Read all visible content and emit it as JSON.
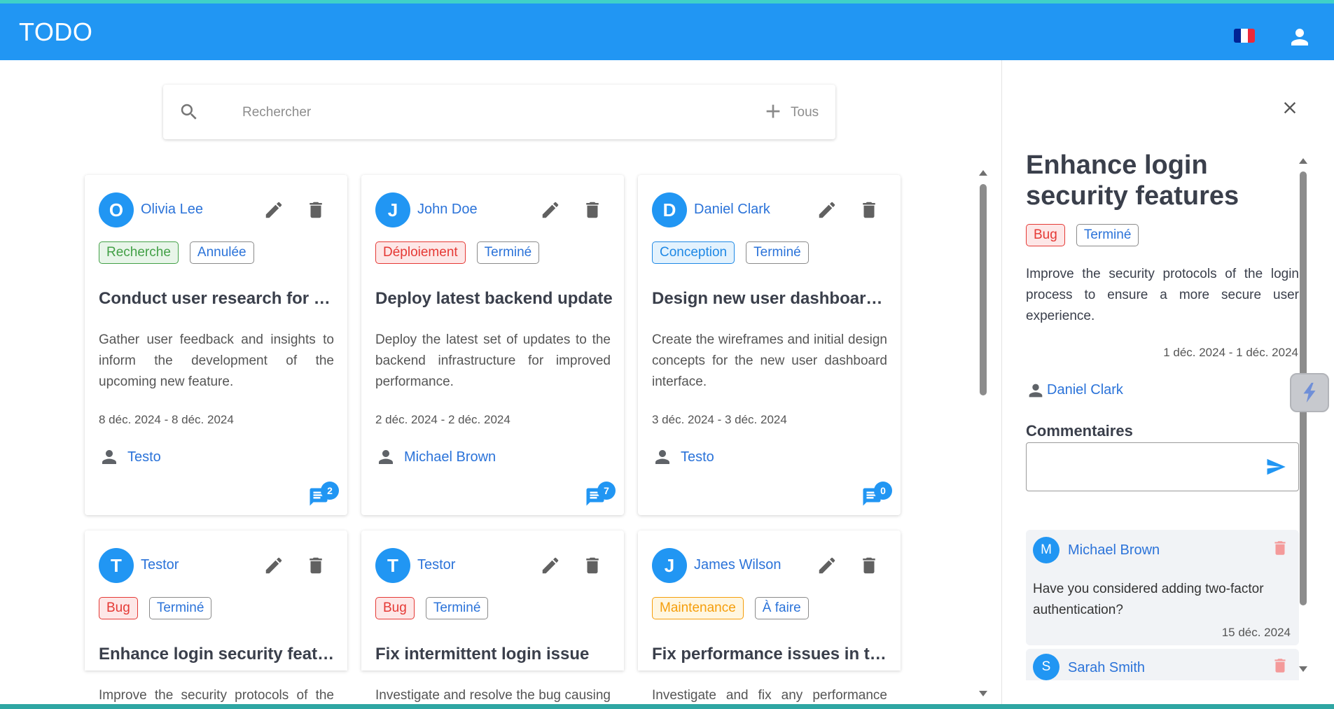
{
  "app": {
    "title": "TODO"
  },
  "flag": {
    "colors": [
      "#002395",
      "#ffffff",
      "#ed2939"
    ]
  },
  "search": {
    "placeholder": "Rechercher",
    "filter_label": "Tous"
  },
  "tasks": [
    {
      "initial": "O",
      "author": "Olivia Lee",
      "category": "Recherche",
      "category_color": "#43a047",
      "category_bg": "#e8f5e9",
      "status": "Annulée",
      "title": "Conduct user research for new feature",
      "description": "Gather user feedback and insights to inform the development of the upcoming new feature.",
      "dates": "8 déc. 2024 - 8 déc. 2024",
      "assignee": "Testo",
      "comments": "2"
    },
    {
      "initial": "J",
      "author": "John Doe",
      "category": "Déploiement",
      "category_color": "#e53935",
      "category_bg": "#fde7e7",
      "status": "Terminé",
      "title": "Deploy latest backend update",
      "description": "Deploy the latest set of updates to the backend infrastructure for improved performance.",
      "dates": "2 déc. 2024 - 2 déc. 2024",
      "assignee": "Michael Brown",
      "comments": "7"
    },
    {
      "initial": "D",
      "author": "Daniel Clark",
      "category": "Conception",
      "category_color": "#1e88e5",
      "category_bg": "#e3f2fd",
      "status": "Terminé",
      "title": "Design new user dashboard interface",
      "description": "Create the wireframes and initial design concepts for the new user dashboard interface.",
      "dates": "3 déc. 2024 - 3 déc. 2024",
      "assignee": "Testo",
      "comments": "0"
    },
    {
      "initial": "T",
      "author": "Testor",
      "category": "Bug",
      "category_color": "#e53935",
      "category_bg": "#fde7e7",
      "status": "Terminé",
      "title": "Enhance login security features",
      "description": "Improve the security protocols of the login process."
    },
    {
      "initial": "T",
      "author": "Testor",
      "category": "Bug",
      "category_color": "#e53935",
      "category_bg": "#fde7e7",
      "status": "Terminé",
      "title": "Fix intermittent login issue",
      "description": "Investigate and resolve the bug causing login failures."
    },
    {
      "initial": "J",
      "author": "James Wilson",
      "category": "Maintenance",
      "category_color": "#f59e0b",
      "category_bg": "#fff6e0",
      "status": "À faire",
      "title": "Fix performance issues in the application",
      "description": "Investigate and fix any performance issues."
    }
  ],
  "detail": {
    "title": "Enhance login security features",
    "category": "Bug",
    "category_color": "#e53935",
    "category_bg": "#fde7e7",
    "status": "Terminé",
    "description": "Improve the security protocols of the login process to ensure a more secure user experience.",
    "dates": "1 déc. 2024 - 1 déc. 2024",
    "assignee": "Daniel Clark",
    "comments_heading": "Commentaires",
    "comments": [
      {
        "initial": "M",
        "author": "Michael Brown",
        "text": "Have you considered adding two-factor authentication?",
        "date": "15 déc. 2024"
      },
      {
        "initial": "S",
        "author": "Sarah Smith"
      }
    ]
  },
  "icons": {
    "search": "search-icon",
    "add": "plus-icon",
    "edit": "pencil-icon",
    "delete": "trash-icon",
    "person": "person-icon",
    "comment": "comment-icon",
    "close": "close-icon",
    "send": "send-icon",
    "user": "account-icon",
    "float": "lightning-icon"
  },
  "colors": {
    "primary": "#2196f3",
    "link": "#2b73d9",
    "delete_light": "#f49a9a"
  }
}
